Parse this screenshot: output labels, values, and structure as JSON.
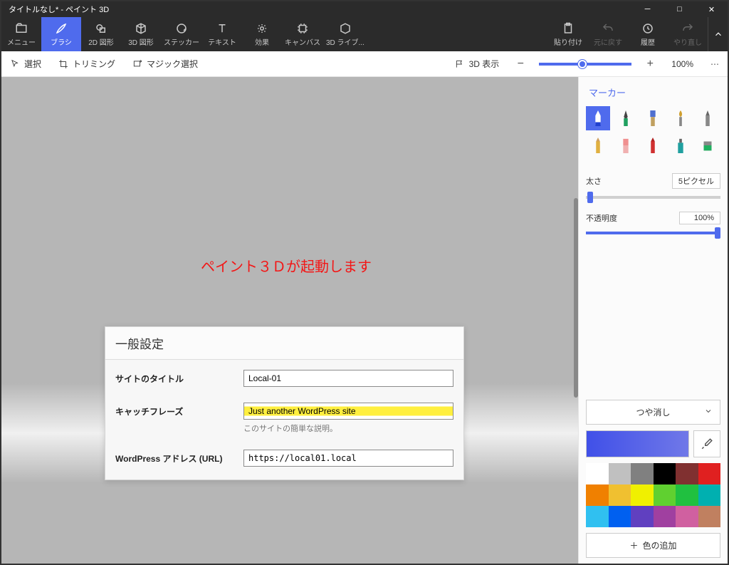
{
  "window_title": "タイトルなし* - ペイント 3D",
  "ribbon": {
    "menu": "メニュー",
    "brush": "ブラシ",
    "shapes2d": "2D 図形",
    "shapes3d": "3D 図形",
    "sticker": "ステッカー",
    "text": "テキスト",
    "effects": "効果",
    "canvas": "キャンバス",
    "lib3d": "3D ライブ...",
    "paste": "貼り付け",
    "undo": "元に戻す",
    "history": "履歴",
    "redo": "やり直し"
  },
  "subbar": {
    "select": "選択",
    "trimming": "トリミング",
    "magic": "マジック選択",
    "view3d": "3D 表示",
    "zoom": "100%"
  },
  "canvas": {
    "red_text": "ペイント３Ｄが起動します",
    "form_header": "一般設定",
    "rows": [
      {
        "label": "サイトのタイトル",
        "value": "Local-01",
        "note": ""
      },
      {
        "label": "キャッチフレーズ",
        "value": "Just another WordPress site",
        "note": "このサイトの簡単な説明。"
      },
      {
        "label": "WordPress アドレス (URL)",
        "value": "https://local01.local",
        "note": ""
      }
    ]
  },
  "sidebar": {
    "title": "マーカー",
    "thickness_label": "太さ",
    "thickness_value": "5ピクセル",
    "opacity_label": "不透明度",
    "opacity_value": "100%",
    "finish": "つや消し",
    "add_color": "色の追加",
    "palette": [
      "#ffffff",
      "#c0c0c0",
      "#808080",
      "#000000",
      "#803030",
      "#e02020",
      "#f08000",
      "#f0c030",
      "#f0f000",
      "#60d030",
      "#20c040",
      "#00b0b0",
      "#30c0f0",
      "#0060f0",
      "#6040c0",
      "#a040a0",
      "#d060a0",
      "#c08060"
    ]
  }
}
